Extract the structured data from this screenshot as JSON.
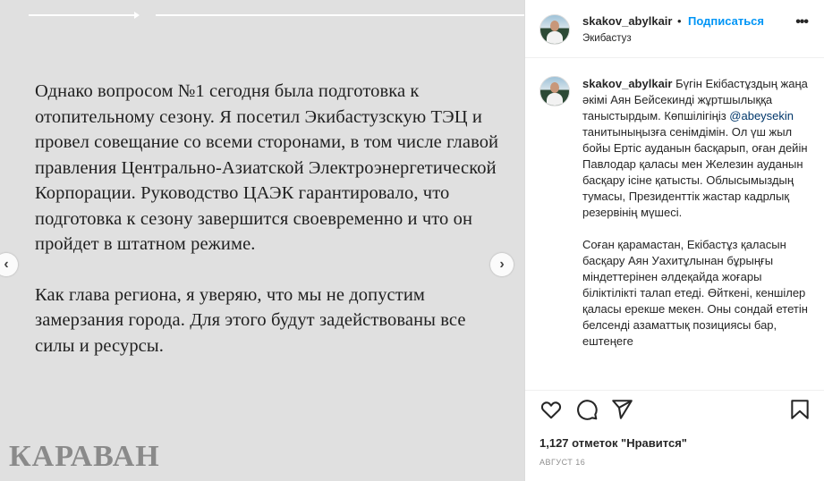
{
  "slide": {
    "paragraphs": [
      "Однако вопросом №1 сегодня была подготовка к отопительному сезону. Я посетил Экибастузскую ТЭЦ и провел совещание со всеми сторонами, в том числе главой правления Центрально-Азиатской Электроэнергетической Корпорации. Руководство ЦАЭК гарантировало, что подготовка к сезону завершится своевременно и что он пройдет в штатном режиме.",
      "Как глава региона, я уверяю, что мы не допустим замерзания города. Для этого будут задействованы все силы и ресурсы."
    ],
    "watermark": "КАРАВАН",
    "prev_icon": "chevron-left-icon",
    "next_icon": "chevron-right-icon",
    "progress_total": 2,
    "progress_current": 1
  },
  "post": {
    "username": "skakov_abylkair",
    "dot": "•",
    "follow_label": "Подписаться",
    "location": "Экибастуз",
    "more_icon": "more-horizontal-icon",
    "caption_username": "skakov_abylkair",
    "caption_p1_a": "Бүгін Екібастұздың жаңа әкімі Аян Бейсекинді жұртшылыққа таныстырдым. Көпшілігіңіз ",
    "caption_mention": "@abeysekin",
    "caption_p1_b": " танитыныңызға сенімдімін. Ол үш жыл бойы Ертіс ауданын басқарып, оған дейін Павлодар қаласы мен Железин ауданын басқару ісіне қатысты. Облысымыздың тумасы, Президенттік жастар кадрлық резервінің мүшесі.",
    "caption_p2": "Соған қарамастан, Екібастұз қаласын басқару Аян Уахитұлынан бұрыңғы міндеттерінен әлдеқайда жоғары біліктілікті талап етеді. Өйткені, кеншілер қаласы ерекше мекен. Оны сондай ететін белсенді азаматтық позициясы бар, ештеңеге",
    "likes": "1,127 отметок \"Нравится\"",
    "date": "АВГУСТ 16",
    "icons": [
      "heart-icon",
      "comment-icon",
      "share-icon",
      "bookmark-icon"
    ]
  }
}
